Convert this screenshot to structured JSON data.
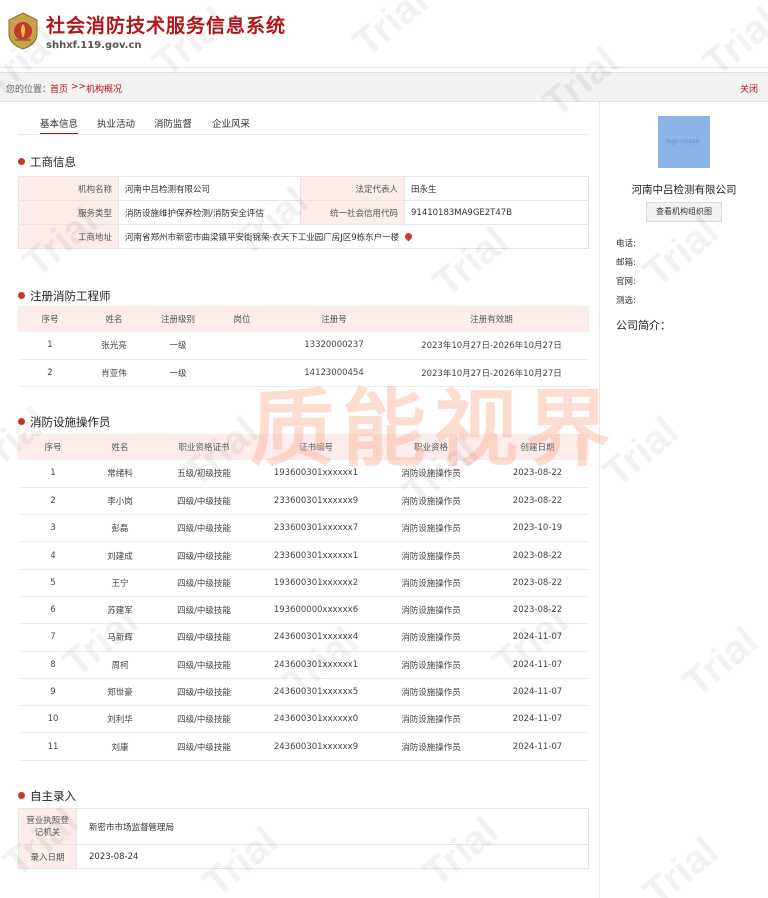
{
  "header": {
    "title": "社会消防技术服务信息系统",
    "domain": "shhxf.119.gov.cn"
  },
  "location": {
    "label": "您的位置：",
    "home": "首页",
    "sep": ">>",
    "current": "机构概况",
    "close": "关闭"
  },
  "tabs": [
    "基本信息",
    "执业活动",
    "消防监督",
    "企业风采"
  ],
  "business": {
    "title": "工商信息",
    "name_label": "机构名称",
    "name": "河南中吕检测有限公司",
    "rep_label": "法定代表人",
    "rep": "田永生",
    "type_label": "服务类型",
    "type": "消防设施维护保养检测/消防安全评估",
    "credit_label": "统一社会信用代码",
    "credit": "91410183MA9GE2T47B",
    "addr_label": "工商地址",
    "addr": "河南省郑州市新密市曲梁镇平安街锦荣·衣天下工业园厂房J区9栋东户一楼"
  },
  "engineers": {
    "title": "注册消防工程师",
    "headers": [
      "序号",
      "姓名",
      "注册级别",
      "岗位",
      "注册号",
      "注册有效期"
    ],
    "rows": [
      [
        "1",
        "张光亮",
        "一级",
        "",
        "13320000237",
        "2023年10月27日-2026年10月27日"
      ],
      [
        "2",
        "肖亚伟",
        "一级",
        "",
        "14123000454",
        "2023年10月27日-2026年10月27日"
      ]
    ]
  },
  "operators": {
    "title": "消防设施操作员",
    "headers": [
      "序号",
      "姓名",
      "职业资格证书",
      "证书编号",
      "职业资格",
      "创建日期"
    ],
    "rows": [
      [
        "1",
        "常绪科",
        "五级/初级技能",
        "193600301xxxxxx1",
        "消防设施操作员",
        "2023-08-22"
      ],
      [
        "2",
        "李小岗",
        "四级/中级技能",
        "233600301xxxxxx9",
        "消防设施操作员",
        "2023-08-22"
      ],
      [
        "3",
        "彭磊",
        "四级/中级技能",
        "233600301xxxxxx7",
        "消防设施操作员",
        "2023-10-19"
      ],
      [
        "4",
        "刘建成",
        "四级/中级技能",
        "233600301xxxxxx1",
        "消防设施操作员",
        "2023-08-22"
      ],
      [
        "5",
        "王宁",
        "四级/中级技能",
        "193600301xxxxxx2",
        "消防设施操作员",
        "2023-08-22"
      ],
      [
        "6",
        "苏建军",
        "四级/中级技能",
        "193600000xxxxxx6",
        "消防设施操作员",
        "2023-08-22"
      ],
      [
        "7",
        "马新辉",
        "四级/中级技能",
        "243600301xxxxxx4",
        "消防设施操作员",
        "2024-11-07"
      ],
      [
        "8",
        "周柯",
        "四级/中级技能",
        "243600301xxxxxx1",
        "消防设施操作员",
        "2024-11-07"
      ],
      [
        "9",
        "郑世豪",
        "四级/中级技能",
        "243600301xxxxxx5",
        "消防设施操作员",
        "2024-11-07"
      ],
      [
        "10",
        "刘利华",
        "四级/中级技能",
        "243600301xxxxxx0",
        "消防设施操作员",
        "2024-11-07"
      ],
      [
        "11",
        "刘康",
        "四级/中级技能",
        "243600301xxxxxx9",
        "消防设施操作员",
        "2024-11-07"
      ]
    ]
  },
  "self_entry": {
    "title": "自主录入",
    "authority_label": "营业执照登记机关",
    "authority": "新密市市场监督管理局",
    "date_label": "录入日期",
    "date": "2023-08-24"
  },
  "side": {
    "name": "河南中吕检测有限公司",
    "button": "查看机构组织图",
    "phone_label": "电话:",
    "email_label": "邮箱:",
    "website_label": "官网:",
    "fax_label": "测选:",
    "intro_label": "公司简介："
  },
  "watermark": {
    "text": "质能视界",
    "trial": "Trial"
  },
  "colors": {
    "brand_red": "#b0161c",
    "header_pink": "#fcecea"
  }
}
